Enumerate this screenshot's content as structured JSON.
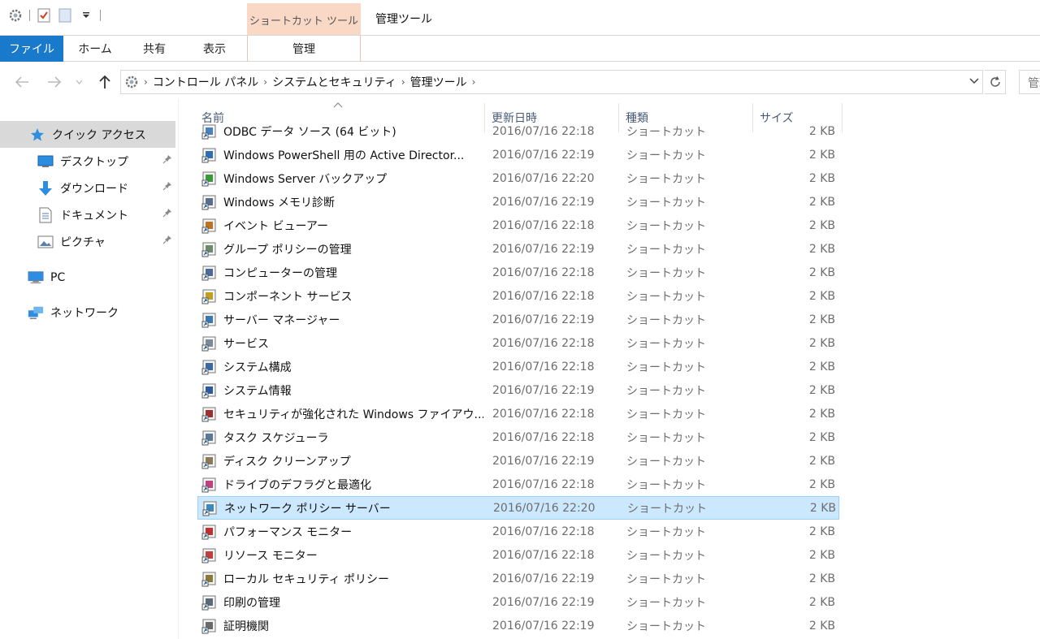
{
  "titlebar": {
    "context_tab": "ショートカット ツール",
    "title": "管理ツール",
    "qat_icons": [
      "settings-icon",
      "properties-icon",
      "new-folder-icon",
      "customize-qat-dropdown-icon"
    ]
  },
  "ribbon": {
    "tabs": [
      "ファイル",
      "ホーム",
      "共有",
      "表示",
      "管理"
    ]
  },
  "address": {
    "breadcrumbs": [
      "コントロール パネル",
      "システムとセキュリティ",
      "管理ツール"
    ],
    "search_placeholder": "管理ツールの検索"
  },
  "nav": {
    "quick_access": "クイック アクセス",
    "items": [
      {
        "label": "デスクトップ",
        "icon": "desktop-icon",
        "pinned": true
      },
      {
        "label": "ダウンロード",
        "icon": "download-icon",
        "pinned": true
      },
      {
        "label": "ドキュメント",
        "icon": "documents-icon",
        "pinned": true
      },
      {
        "label": "ピクチャ",
        "icon": "pictures-icon",
        "pinned": true
      }
    ],
    "pc": "PC",
    "network": "ネットワーク"
  },
  "columns": {
    "name": "名前",
    "date": "更新日時",
    "type": "種類",
    "size": "サイズ"
  },
  "files": [
    {
      "name": "ODBC データ ソース (64 ビット)",
      "date": "2016/07/16 22:18",
      "type": "ショートカット",
      "size": "2 KB"
    },
    {
      "name": "Windows PowerShell 用の Active Director...",
      "date": "2016/07/16 22:19",
      "type": "ショートカット",
      "size": "2 KB"
    },
    {
      "name": "Windows Server バックアップ",
      "date": "2016/07/16 22:20",
      "type": "ショートカット",
      "size": "2 KB"
    },
    {
      "name": "Windows メモリ診断",
      "date": "2016/07/16 22:19",
      "type": "ショートカット",
      "size": "2 KB"
    },
    {
      "name": "イベント ビューアー",
      "date": "2016/07/16 22:18",
      "type": "ショートカット",
      "size": "2 KB"
    },
    {
      "name": "グループ ポリシーの管理",
      "date": "2016/07/16 22:19",
      "type": "ショートカット",
      "size": "2 KB"
    },
    {
      "name": "コンピューターの管理",
      "date": "2016/07/16 22:18",
      "type": "ショートカット",
      "size": "2 KB"
    },
    {
      "name": "コンポーネント サービス",
      "date": "2016/07/16 22:18",
      "type": "ショートカット",
      "size": "2 KB"
    },
    {
      "name": "サーバー マネージャー",
      "date": "2016/07/16 22:19",
      "type": "ショートカット",
      "size": "2 KB"
    },
    {
      "name": "サービス",
      "date": "2016/07/16 22:18",
      "type": "ショートカット",
      "size": "2 KB"
    },
    {
      "name": "システム構成",
      "date": "2016/07/16 22:18",
      "type": "ショートカット",
      "size": "2 KB"
    },
    {
      "name": "システム情報",
      "date": "2016/07/16 22:19",
      "type": "ショートカット",
      "size": "2 KB"
    },
    {
      "name": "セキュリティが強化された Windows ファイアウ...",
      "date": "2016/07/16 22:18",
      "type": "ショートカット",
      "size": "2 KB"
    },
    {
      "name": "タスク スケジューラ",
      "date": "2016/07/16 22:18",
      "type": "ショートカット",
      "size": "2 KB"
    },
    {
      "name": "ディスク クリーンアップ",
      "date": "2016/07/16 22:19",
      "type": "ショートカット",
      "size": "2 KB"
    },
    {
      "name": "ドライブのデフラグと最適化",
      "date": "2016/07/16 22:18",
      "type": "ショートカット",
      "size": "2 KB"
    },
    {
      "name": "ネットワーク ポリシー サーバー",
      "date": "2016/07/16 22:20",
      "type": "ショートカット",
      "size": "2 KB",
      "selected": true
    },
    {
      "name": "パフォーマンス モニター",
      "date": "2016/07/16 22:18",
      "type": "ショートカット",
      "size": "2 KB"
    },
    {
      "name": "リソース モニター",
      "date": "2016/07/16 22:18",
      "type": "ショートカット",
      "size": "2 KB"
    },
    {
      "name": "ローカル セキュリティ ポリシー",
      "date": "2016/07/16 22:19",
      "type": "ショートカット",
      "size": "2 KB"
    },
    {
      "name": "印刷の管理",
      "date": "2016/07/16 22:19",
      "type": "ショートカット",
      "size": "2 KB"
    },
    {
      "name": "証明機関",
      "date": "2016/07/16 22:19",
      "type": "ショートカット",
      "size": "2 KB"
    }
  ],
  "colors": {
    "file_tab": "#1979ca",
    "context_tab": "#f9d9c6",
    "selection": "#cce8ff",
    "selection_border": "#99d1ff"
  }
}
